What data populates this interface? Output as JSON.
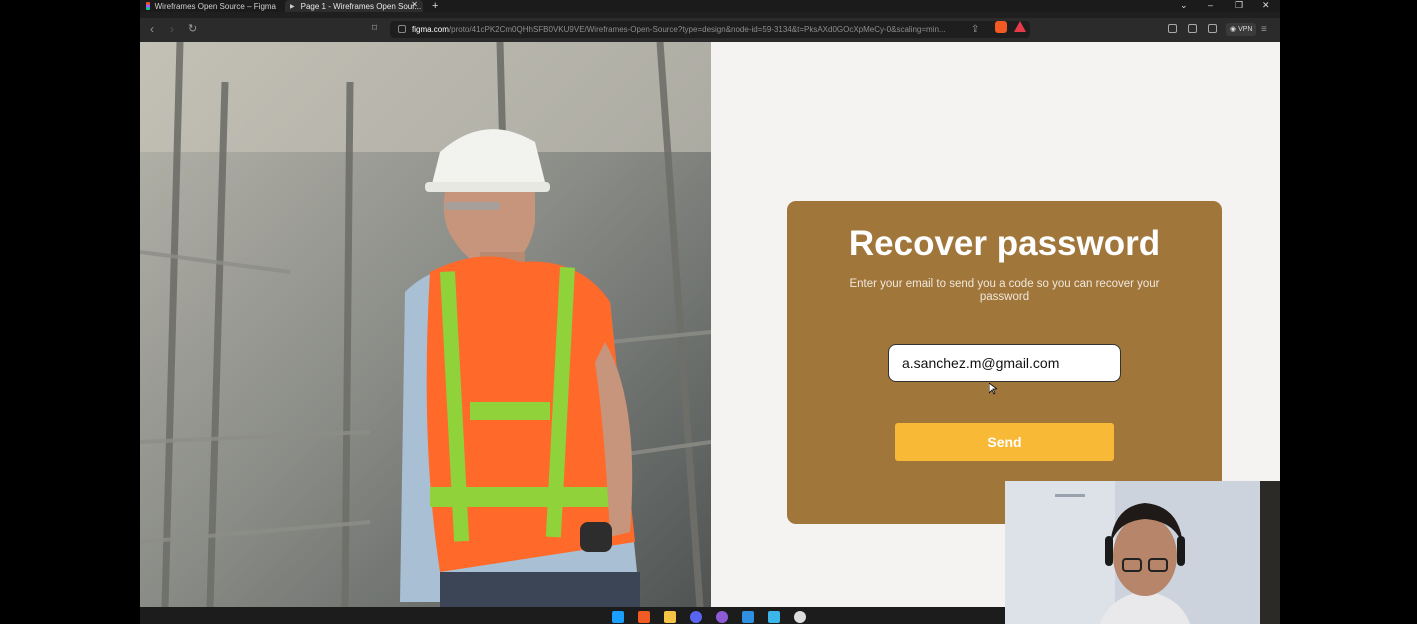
{
  "browser": {
    "tabs": [
      {
        "label": "Wireframes Open Source – Figma",
        "active": false
      },
      {
        "label": "Page 1 - Wireframes Open Sour...",
        "active": true
      }
    ],
    "url_host": "figma.com",
    "url_path": "/proto/41cPK2Cm0QHhSFB0VKU9VE/Wireframes-Open-Source?type=design&node-id=59-3134&t=PksAXd0GOcXpMeCy-0&scaling=min...",
    "vpn_label": "VPN"
  },
  "card": {
    "title": "Recover password",
    "subtitle": "Enter your email to send you a code so you can recover your password",
    "email_value": "a.sanchez.m@gmail.com",
    "send_label": "Send"
  },
  "colors": {
    "card_bg": "#a0763b",
    "button_bg": "#f8b936",
    "page_bg": "#f4f3f1"
  },
  "taskbar": {
    "icons": [
      "windows-start-icon",
      "brave-icon",
      "file-explorer-icon",
      "discord-icon",
      "obs-icon",
      "vscode-icon",
      "notepad-icon",
      "chrome-icon"
    ]
  }
}
